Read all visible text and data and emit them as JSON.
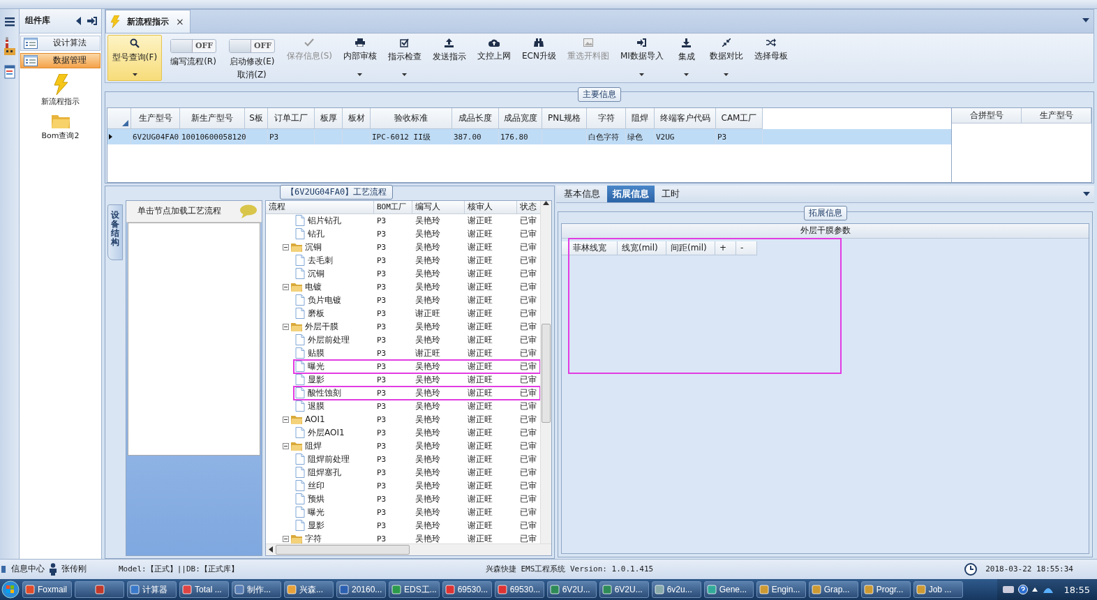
{
  "sidebar": {
    "title": "组件库",
    "items": [
      {
        "label": "设计算法",
        "selected": false
      },
      {
        "label": "数据管理",
        "selected": true
      }
    ],
    "shortcuts": [
      {
        "label": "新流程指示"
      },
      {
        "label": "Bom查询2"
      }
    ]
  },
  "document_tab": {
    "title": "新流程指示",
    "close": "×"
  },
  "toolbar": {
    "items": [
      {
        "kind": "button",
        "label": "型号查询(F)",
        "selected": true,
        "disabled": false,
        "dropdown": true
      },
      {
        "kind": "toggle",
        "label": "编写流程(R)",
        "switch_text": "OFF",
        "on": false
      },
      {
        "kind": "toggle",
        "label": "启动修改(E)",
        "sublabel": "取消(Z)",
        "switch_text": "OFF",
        "on": false
      },
      {
        "kind": "button",
        "label": "保存信息(S)",
        "selected": false,
        "disabled": true,
        "dropdown": false
      },
      {
        "kind": "button",
        "label": "内部审核",
        "selected": false,
        "disabled": false,
        "dropdown": true
      },
      {
        "kind": "button",
        "label": "指示检查",
        "selected": false,
        "disabled": false,
        "dropdown": true
      },
      {
        "kind": "button",
        "label": "发送指示",
        "selected": false,
        "disabled": false,
        "dropdown": false
      },
      {
        "kind": "button",
        "label": "文控上网",
        "selected": false,
        "disabled": false,
        "dropdown": false
      },
      {
        "kind": "button",
        "label": "ECN升级",
        "selected": false,
        "disabled": false,
        "dropdown": false
      },
      {
        "kind": "button",
        "label": "重选开料图",
        "selected": false,
        "disabled": true,
        "dropdown": false
      },
      {
        "kind": "button",
        "label": "MI数据导入",
        "selected": false,
        "disabled": false,
        "dropdown": true
      },
      {
        "kind": "button",
        "label": "集成",
        "selected": false,
        "disabled": false,
        "dropdown": true
      },
      {
        "kind": "button",
        "label": "数据对比",
        "selected": false,
        "disabled": false,
        "dropdown": true
      },
      {
        "kind": "button",
        "label": "选择母板",
        "selected": false,
        "disabled": false,
        "dropdown": false
      }
    ]
  },
  "main_info": {
    "title": "主要信息",
    "columns": [
      "生产型号",
      "新生产型号",
      "S板",
      "订单工厂",
      "板厚",
      "板材",
      "验收标准",
      "成品长度",
      "成品宽度",
      "PNL规格",
      "字符",
      "阻焊",
      "终端客户代码",
      "CAM工厂"
    ],
    "rows": [
      {
        "selected": true,
        "cells": [
          "6V2UG04FA0",
          "10010600058120",
          null,
          "P3",
          null,
          null,
          "IPC-6012 II级",
          "387.00",
          "176.80",
          null,
          "白色字符",
          "绿色",
          "V2UG",
          "P3"
        ]
      }
    ],
    "side_columns": [
      "合拼型号",
      "生产型号"
    ]
  },
  "process_flow": {
    "title": "【6V2UG04FA0】工艺流程",
    "side_tab": "设备结构",
    "hint": "单击节点加载工艺流程",
    "columns": [
      "流程",
      "BOM工厂",
      "编写人",
      "核审人",
      "状态"
    ],
    "tree": [
      {
        "kind": "leaf",
        "label": "铝片钻孔",
        "bom": "P3",
        "writer": "吴艳玲",
        "reviewer": "谢正旺",
        "status": "已审",
        "highlighted": false
      },
      {
        "kind": "leaf",
        "label": "钻孔",
        "bom": "P3",
        "writer": "吴艳玲",
        "reviewer": "谢正旺",
        "status": "已审",
        "highlighted": false
      },
      {
        "kind": "folder",
        "label": "沉铜",
        "expanded": true,
        "bom": "P3",
        "writer": "吴艳玲",
        "reviewer": "谢正旺",
        "status": "已审",
        "highlighted": false,
        "children": [
          {
            "kind": "leaf",
            "label": "去毛刺",
            "bom": "P3",
            "writer": "吴艳玲",
            "reviewer": "谢正旺",
            "status": "已审",
            "highlighted": false
          },
          {
            "kind": "leaf",
            "label": "沉铜",
            "bom": "P3",
            "writer": "吴艳玲",
            "reviewer": "谢正旺",
            "status": "已审",
            "highlighted": false
          }
        ]
      },
      {
        "kind": "folder",
        "label": "电镀",
        "expanded": true,
        "bom": "P3",
        "writer": "吴艳玲",
        "reviewer": "谢正旺",
        "status": "已审",
        "highlighted": false,
        "children": [
          {
            "kind": "leaf",
            "label": "负片电镀",
            "bom": "P3",
            "writer": "吴艳玲",
            "reviewer": "谢正旺",
            "status": "已审",
            "highlighted": false
          },
          {
            "kind": "leaf",
            "label": "磨板",
            "bom": "P3",
            "writer": "谢正旺",
            "reviewer": "谢正旺",
            "status": "已审",
            "highlighted": false
          }
        ]
      },
      {
        "kind": "folder",
        "label": "外层干膜",
        "expanded": true,
        "bom": "P3",
        "writer": "吴艳玲",
        "reviewer": "谢正旺",
        "status": "已审",
        "highlighted": false,
        "children": [
          {
            "kind": "leaf",
            "label": "外层前处理",
            "bom": "P3",
            "writer": "吴艳玲",
            "reviewer": "谢正旺",
            "status": "已审",
            "highlighted": false
          },
          {
            "kind": "leaf",
            "label": "贴膜",
            "bom": "P3",
            "writer": "谢正旺",
            "reviewer": "谢正旺",
            "status": "已审",
            "highlighted": false
          },
          {
            "kind": "leaf",
            "label": "曝光",
            "bom": "P3",
            "writer": "吴艳玲",
            "reviewer": "谢正旺",
            "status": "已审",
            "highlighted": true
          },
          {
            "kind": "leaf",
            "label": "显影",
            "bom": "P3",
            "writer": "吴艳玲",
            "reviewer": "谢正旺",
            "status": "已审",
            "highlighted": false
          },
          {
            "kind": "leaf",
            "label": "酸性蚀刻",
            "bom": "P3",
            "writer": "吴艳玲",
            "reviewer": "谢正旺",
            "status": "已审",
            "highlighted": true
          },
          {
            "kind": "leaf",
            "label": "退膜",
            "bom": "P3",
            "writer": "吴艳玲",
            "reviewer": "谢正旺",
            "status": "已审",
            "highlighted": false
          }
        ]
      },
      {
        "kind": "folder",
        "label": "AOI1",
        "expanded": true,
        "bom": "P3",
        "writer": "吴艳玲",
        "reviewer": "谢正旺",
        "status": "已审",
        "highlighted": false,
        "children": [
          {
            "kind": "leaf",
            "label": "外层AOI1",
            "bom": "P3",
            "writer": "吴艳玲",
            "reviewer": "谢正旺",
            "status": "已审",
            "highlighted": false
          }
        ]
      },
      {
        "kind": "folder",
        "label": "阻焊",
        "expanded": true,
        "bom": "P3",
        "writer": "吴艳玲",
        "reviewer": "谢正旺",
        "status": "已审",
        "highlighted": false,
        "children": [
          {
            "kind": "leaf",
            "label": "阻焊前处理",
            "bom": "P3",
            "writer": "吴艳玲",
            "reviewer": "谢正旺",
            "status": "已审",
            "highlighted": false
          },
          {
            "kind": "leaf",
            "label": "阻焊塞孔",
            "bom": "P3",
            "writer": "吴艳玲",
            "reviewer": "谢正旺",
            "status": "已审",
            "highlighted": false
          },
          {
            "kind": "leaf",
            "label": "丝印",
            "bom": "P3",
            "writer": "吴艳玲",
            "reviewer": "谢正旺",
            "status": "已审",
            "highlighted": false
          },
          {
            "kind": "leaf",
            "label": "预烘",
            "bom": "P3",
            "writer": "吴艳玲",
            "reviewer": "谢正旺",
            "status": "已审",
            "highlighted": false
          },
          {
            "kind": "leaf",
            "label": "曝光",
            "bom": "P3",
            "writer": "吴艳玲",
            "reviewer": "谢正旺",
            "status": "已审",
            "highlighted": false
          },
          {
            "kind": "leaf",
            "label": "显影",
            "bom": "P3",
            "writer": "吴艳玲",
            "reviewer": "谢正旺",
            "status": "已审",
            "highlighted": false
          }
        ]
      },
      {
        "kind": "folder",
        "label": "字符",
        "expanded": true,
        "bom": "P3",
        "writer": "吴艳玲",
        "reviewer": "谢正旺",
        "status": "已审",
        "highlighted": false
      }
    ]
  },
  "extension": {
    "tabs": [
      {
        "label": "基本信息",
        "selected": false
      },
      {
        "label": "拓展信息",
        "selected": true
      },
      {
        "label": "工时",
        "selected": false
      }
    ],
    "group_title": "拓展信息",
    "table_title": "外层干膜参数",
    "columns": [
      "菲林线宽",
      "线宽(mil)",
      "间距(mil)",
      "+",
      "-"
    ],
    "highlighted": true
  },
  "status_bar": {
    "info": "信息中心",
    "user": "张传刚",
    "model": "Model:【正式】||DB:【正式库】",
    "app": "兴森快捷 EMS工程系统 Version: 1.0.1.415",
    "datetime": "2018-03-22 18:55:34"
  },
  "taskbar": {
    "items": [
      {
        "kind": "app",
        "label": "Foxmail"
      },
      {
        "kind": "icon"
      },
      {
        "kind": "app",
        "label": "计算器"
      },
      {
        "kind": "app",
        "label": "Total ..."
      },
      {
        "kind": "app",
        "label": "制作..."
      },
      {
        "kind": "app",
        "label": "兴森..."
      },
      {
        "kind": "app",
        "label": "20160..."
      },
      {
        "kind": "app",
        "label": "EDS工..."
      },
      {
        "kind": "app",
        "label": "69530..."
      },
      {
        "kind": "app",
        "label": "69530..."
      },
      {
        "kind": "app",
        "label": "6V2U..."
      },
      {
        "kind": "app",
        "label": "6V2U..."
      },
      {
        "kind": "app",
        "label": "6v2u..."
      },
      {
        "kind": "app",
        "label": "Gene..."
      },
      {
        "kind": "app",
        "label": "Engin..."
      },
      {
        "kind": "app",
        "label": "Grap..."
      },
      {
        "kind": "app",
        "label": "Progr..."
      },
      {
        "kind": "app",
        "label": "Job ..."
      }
    ],
    "clock": "18:55"
  }
}
